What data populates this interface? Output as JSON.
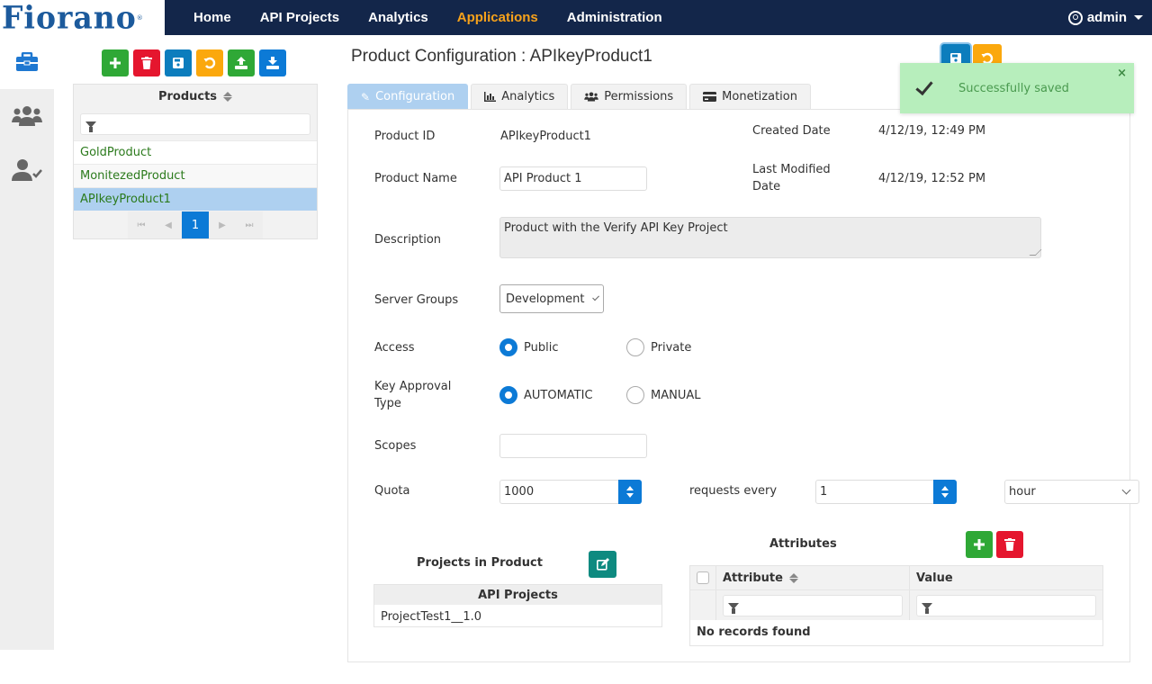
{
  "brand": {
    "logo_text": "Fiorano",
    "logo_mark": "®"
  },
  "nav": {
    "items": [
      {
        "label": "Home",
        "active": false
      },
      {
        "label": "API Projects",
        "active": false
      },
      {
        "label": "Analytics",
        "active": false
      },
      {
        "label": "Applications",
        "active": true
      },
      {
        "label": "Administration",
        "active": false
      }
    ],
    "user": "admin"
  },
  "rail": {
    "items": [
      {
        "icon": "briefcase-icon",
        "active": true
      },
      {
        "icon": "users-icon",
        "active": false
      },
      {
        "icon": "user-check-icon",
        "active": false
      }
    ]
  },
  "product_toolbar": {
    "buttons": [
      {
        "icon": "plus-icon",
        "glyph": "+",
        "label": "Add"
      },
      {
        "icon": "trash-icon",
        "glyph": "🗑",
        "label": "Delete"
      },
      {
        "icon": "save-icon",
        "glyph": "💾",
        "label": "Save"
      },
      {
        "icon": "undo-icon",
        "glyph": "↺",
        "label": "Revert"
      },
      {
        "icon": "upload-icon",
        "glyph": "⇪",
        "label": "Import"
      },
      {
        "icon": "download-icon",
        "glyph": "⤓",
        "label": "Export"
      }
    ]
  },
  "products": {
    "header": "Products",
    "filter_placeholder": "",
    "items": [
      {
        "name": "GoldProduct",
        "selected": false
      },
      {
        "name": "MonitezedProduct",
        "selected": false
      },
      {
        "name": "APIkeyProduct1",
        "selected": true
      }
    ],
    "pager": {
      "current_page": "1"
    }
  },
  "page": {
    "title": "Product Configuration : APIkeyProduct1"
  },
  "tabs": [
    {
      "label": "Configuration",
      "icon": "pencil-icon",
      "glyph": "✎",
      "active": true
    },
    {
      "label": "Analytics",
      "icon": "bar-chart-icon",
      "glyph": "▥",
      "active": false
    },
    {
      "label": "Permissions",
      "icon": "users-icon",
      "glyph": "👥",
      "active": false
    },
    {
      "label": "Monetization",
      "icon": "credit-card-icon",
      "glyph": "▬",
      "active": false
    }
  ],
  "form": {
    "product_id": {
      "label": "Product ID",
      "value": "APIkeyProduct1"
    },
    "product_name": {
      "label": "Product Name",
      "value": "API Product 1"
    },
    "created_date": {
      "label": "Created Date",
      "value": "4/12/19, 12:49 PM"
    },
    "last_modified": {
      "label": "Last Modified Date",
      "value": "4/12/19, 12:52 PM"
    },
    "description": {
      "label": "Description",
      "value": "Product with the Verify API Key Project"
    },
    "server_groups": {
      "label": "Server Groups",
      "value": "Development"
    },
    "access": {
      "label": "Access",
      "options": [
        "Public",
        "Private"
      ],
      "selected": "Public"
    },
    "key_approval": {
      "label": "Key Approval Type",
      "options": [
        "AUTOMATIC",
        "MANUAL"
      ],
      "selected": "AUTOMATIC"
    },
    "scopes": {
      "label": "Scopes",
      "value": ""
    },
    "quota": {
      "label": "Quota",
      "value": "1000",
      "requests_every_label": "requests every",
      "interval_value": "1",
      "interval_unit": "hour"
    }
  },
  "projects_in_product": {
    "title": "Projects in Product",
    "column": "API Projects",
    "rows": [
      "ProjectTest1__1.0"
    ]
  },
  "attributes": {
    "title": "Attributes",
    "columns": [
      "Attribute",
      "Value"
    ],
    "empty_text": "No records found"
  },
  "toast": {
    "message": "Successfully saved",
    "close": "×"
  }
}
